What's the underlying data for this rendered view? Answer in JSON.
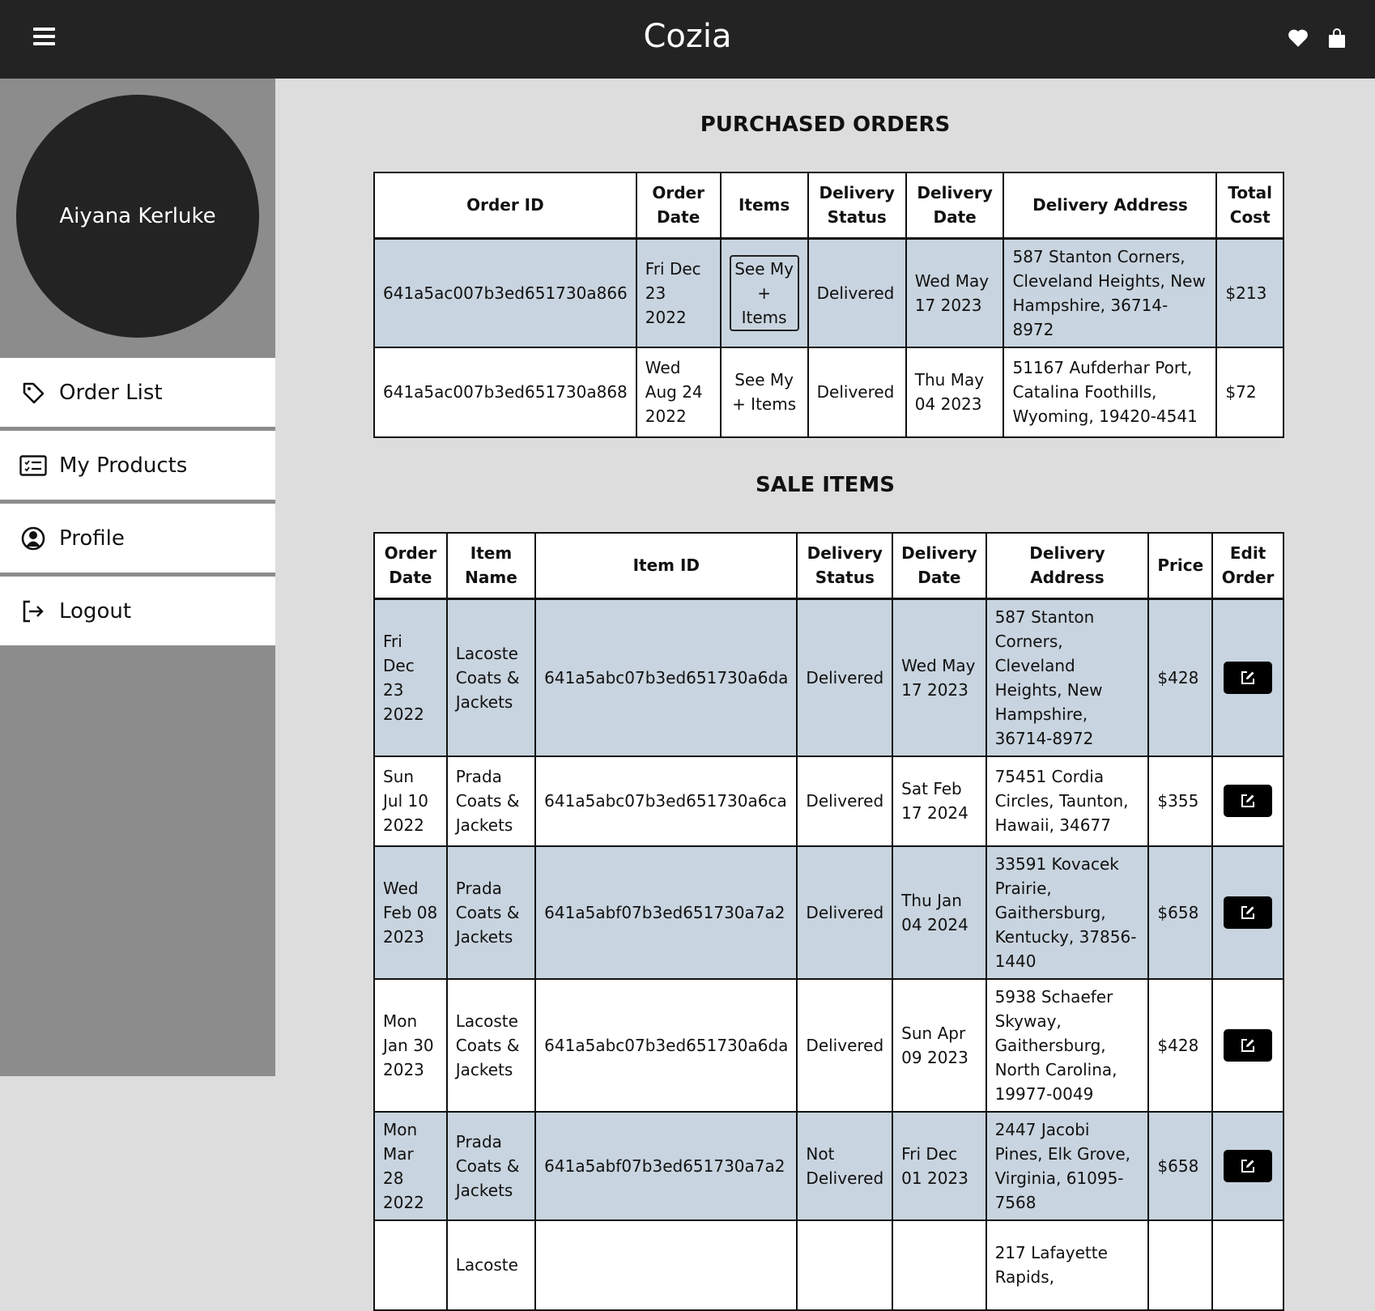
{
  "app": {
    "brand": "Cozia",
    "icons": {
      "menu": "hamburger-menu-icon",
      "wishlist": "heart-icon",
      "cart": "shopping-bag-icon"
    }
  },
  "sidebar": {
    "user_name": "Aiyana Kerluke",
    "items": [
      {
        "label": "Order List",
        "icon": "tag-icon"
      },
      {
        "label": "My Products",
        "icon": "checklist-icon"
      },
      {
        "label": "Profile",
        "icon": "user-circle-icon"
      },
      {
        "label": "Logout",
        "icon": "logout-icon"
      }
    ]
  },
  "purchased": {
    "title": "PURCHASED ORDERS",
    "headers": [
      "Order ID",
      "Order Date",
      "Items",
      "Delivery Status",
      "Delivery Date",
      "Delivery Address",
      "Total Cost"
    ],
    "rows": [
      {
        "order_id": "641a5ac007b3ed651730a866",
        "order_date": "Fri Dec 23 2022",
        "items_label": "See My + Items",
        "status": "Delivered",
        "delivery_date": "Wed May 17 2023",
        "address": "587 Stanton Corners, Cleveland Heights, New Hampshire, 36714-8972",
        "total": "$213"
      },
      {
        "order_id": "641a5ac007b3ed651730a868",
        "order_date": "Wed Aug 24 2022",
        "items_label": "See My + Items",
        "status": "Delivered",
        "delivery_date": "Thu May 04 2023",
        "address": "51167 Aufderhar Port, Catalina Foothills, Wyoming, 19420-4541",
        "total": "$72"
      }
    ]
  },
  "sale": {
    "title": "SALE ITEMS",
    "headers": [
      "Order Date",
      "Item Name",
      "Item ID",
      "Delivery Status",
      "Delivery Date",
      "Delivery Address",
      "Price",
      "Edit Order"
    ],
    "rows": [
      {
        "order_date": "Fri Dec 23 2022",
        "item_name": "Lacoste Coats & Jackets",
        "item_id": "641a5abc07b3ed651730a6da",
        "status": "Delivered",
        "delivery_date": "Wed May 17 2023",
        "address": "587 Stanton Corners, Cleveland Heights, New Hampshire, 36714-8972",
        "price": "$428"
      },
      {
        "order_date": "Sun Jul 10 2022",
        "item_name": "Prada Coats & Jackets",
        "item_id": "641a5abc07b3ed651730a6ca",
        "status": "Delivered",
        "delivery_date": "Sat Feb 17 2024",
        "address": "75451 Cordia Circles, Taunton, Hawaii, 34677",
        "price": "$355"
      },
      {
        "order_date": "Wed Feb 08 2023",
        "item_name": "Prada Coats & Jackets",
        "item_id": "641a5abf07b3ed651730a7a2",
        "status": "Delivered",
        "delivery_date": "Thu Jan 04 2024",
        "address": "33591 Kovacek Prairie, Gaithersburg, Kentucky, 37856-1440",
        "price": "$658"
      },
      {
        "order_date": "Mon Jan 30 2023",
        "item_name": "Lacoste Coats & Jackets",
        "item_id": "641a5abc07b3ed651730a6da",
        "status": "Delivered",
        "delivery_date": "Sun Apr 09 2023",
        "address": "5938 Schaefer Skyway, Gaithersburg, North Carolina, 19977-0049",
        "price": "$428"
      },
      {
        "order_date": "Mon Mar 28 2022",
        "item_name": "Prada Coats & Jackets",
        "item_id": "641a5abf07b3ed651730a7a2",
        "status": "Not Delivered",
        "delivery_date": "Fri Dec 01 2023",
        "address": "2447 Jacobi Pines, Elk Grove, Virginia, 61095-7568",
        "price": "$658"
      },
      {
        "order_date": "",
        "item_name": "Lacoste",
        "item_id": "",
        "status": "",
        "delivery_date": "",
        "address": "217 Lafayette Rapids,",
        "price": ""
      }
    ],
    "edit_icon": "edit-icon"
  },
  "colors": {
    "topbar": "#232323",
    "sidebar": "#8c8c8c",
    "content_bg": "#dddddd",
    "row_shade": "#c8d4df"
  }
}
